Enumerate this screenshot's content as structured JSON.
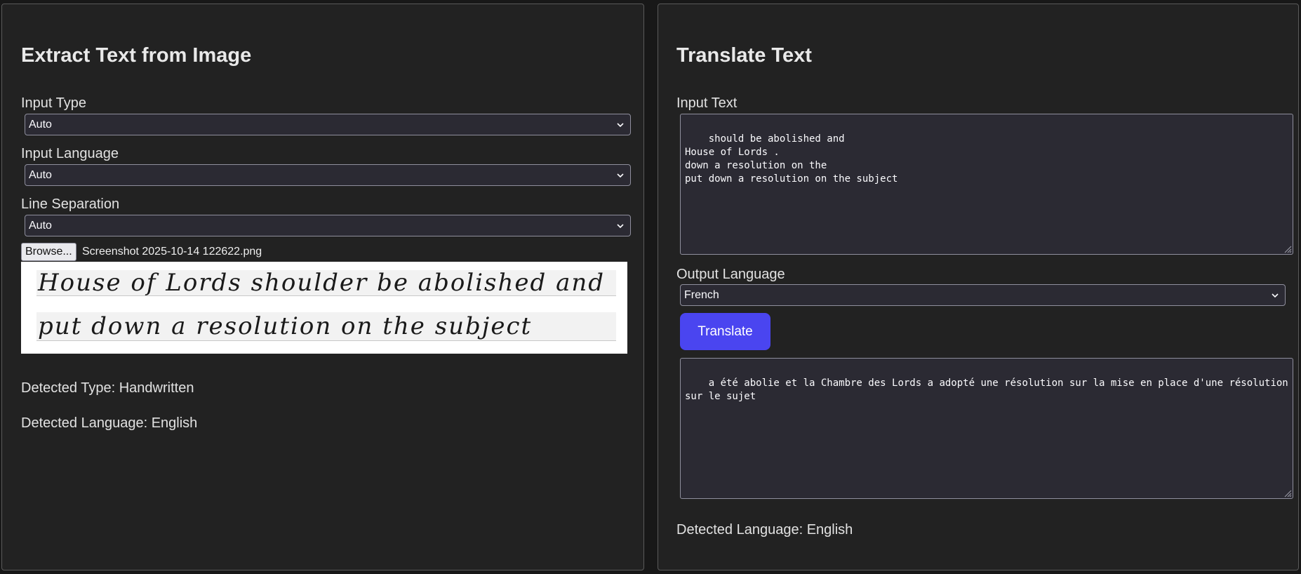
{
  "extract": {
    "title": "Extract Text from Image",
    "input_type": {
      "label": "Input Type",
      "value": "Auto"
    },
    "input_language": {
      "label": "Input Language",
      "value": "Auto"
    },
    "line_separation": {
      "label": "Line Separation",
      "value": "Auto"
    },
    "file": {
      "browse_label": "Browse...",
      "filename": "Screenshot 2025-10-14 122622.png"
    },
    "preview_lines": [
      "House of Lords shoulder be abolished and",
      "put down a resolution on the subject"
    ],
    "detected_type": "Detected Type: Handwritten",
    "detected_language": "Detected Language: English"
  },
  "translate": {
    "title": "Translate Text",
    "input_label": "Input Text",
    "input_text": "should be abolished and\nHouse of Lords .\ndown a resolution on the\nput down a resolution on the subject",
    "output_language": {
      "label": "Output Language",
      "value": "French"
    },
    "button_label": "Translate",
    "output_text": "a été abolie et la Chambre des Lords a adopté une résolution sur la mise en place d'une résolution sur le sujet",
    "detected_language": "Detected Language: English"
  },
  "colors": {
    "background": "#222222",
    "accent": "#4a45f0",
    "field_bg": "#2b2a33"
  },
  "icons": [
    "chevron-down-icon",
    "resize-grip-icon"
  ]
}
